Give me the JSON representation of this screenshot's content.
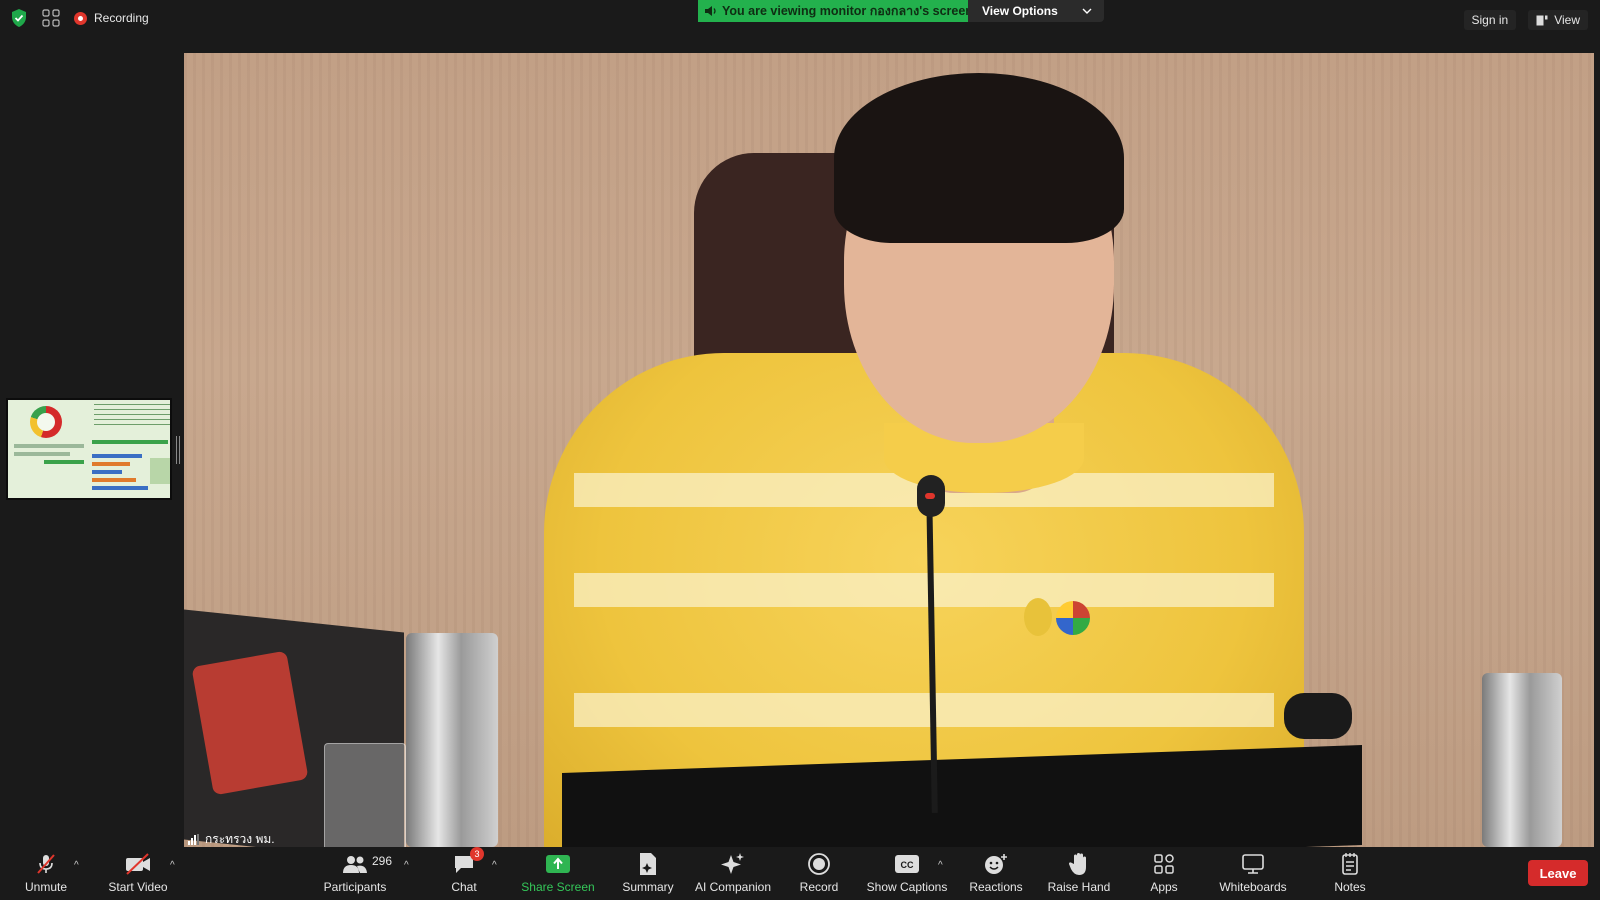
{
  "top_bar": {
    "recording_label": "Recording",
    "share_banner": "You are viewing monitor กองกลาง's screen",
    "view_options_label": "View Options",
    "sign_in_label": "Sign in",
    "view_label": "View"
  },
  "video": {
    "participant_name": "กระทรวง พม."
  },
  "toolbar": {
    "unmute_label": "Unmute",
    "start_video_label": "Start Video",
    "participants_label": "Participants",
    "participants_count": "296",
    "chat_label": "Chat",
    "chat_badge": "3",
    "share_screen_label": "Share Screen",
    "summary_label": "Summary",
    "ai_companion_label": "AI Companion",
    "record_label": "Record",
    "show_captions_label": "Show Captions",
    "reactions_label": "Reactions",
    "raise_hand_label": "Raise Hand",
    "apps_label": "Apps",
    "whiteboards_label": "Whiteboards",
    "notes_label": "Notes",
    "leave_label": "Leave"
  },
  "colors": {
    "share_banner_bg": "#23b14d",
    "leave_bg": "#d52b2b",
    "share_icon": "#34c759",
    "recording_dot": "#e0362c"
  }
}
